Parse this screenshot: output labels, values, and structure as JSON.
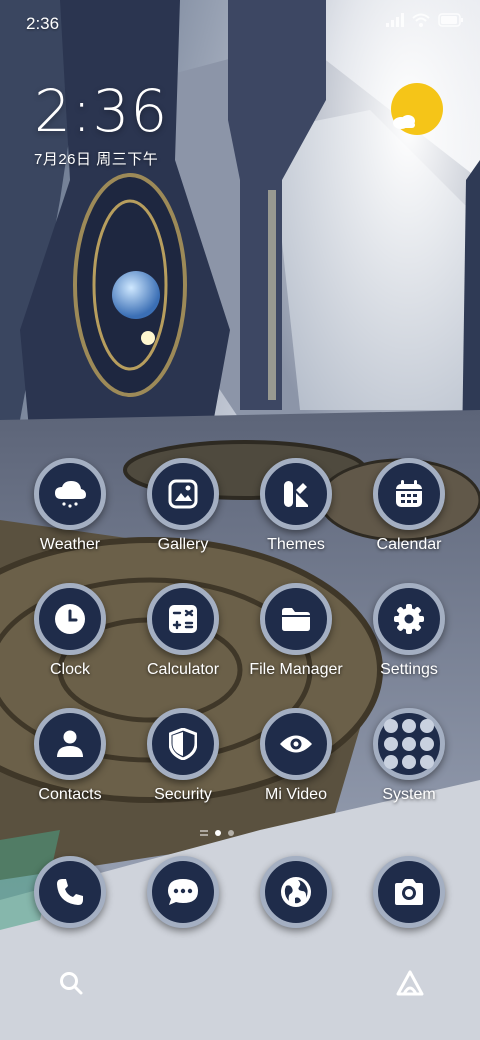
{
  "status_bar": {
    "time": "2:36",
    "icons": [
      "signal-icon",
      "wifi-icon",
      "battery-icon"
    ]
  },
  "clock_widget": {
    "time": "2:36",
    "date": "7月26日 周三下午",
    "weather_icon": "sun-cloud-icon",
    "sun_color": "#f5c518"
  },
  "apps": [
    {
      "label": "Weather",
      "icon": "weather-icon"
    },
    {
      "label": "Gallery",
      "icon": "gallery-icon"
    },
    {
      "label": "Themes",
      "icon": "themes-icon"
    },
    {
      "label": "Calendar",
      "icon": "calendar-icon"
    },
    {
      "label": "Clock",
      "icon": "clock-icon"
    },
    {
      "label": "Calculator",
      "icon": "calculator-icon"
    },
    {
      "label": "File Manager",
      "icon": "folder-icon"
    },
    {
      "label": "Settings",
      "icon": "gear-icon"
    },
    {
      "label": "Contacts",
      "icon": "contacts-icon"
    },
    {
      "label": "Security",
      "icon": "shield-icon"
    },
    {
      "label": "Mi Video",
      "icon": "eye-icon"
    },
    {
      "label": "System",
      "icon": "folder-grid-icon"
    }
  ],
  "dock": [
    {
      "icon": "phone-icon"
    },
    {
      "icon": "message-icon"
    },
    {
      "icon": "browser-globe-icon"
    },
    {
      "icon": "camera-icon"
    }
  ],
  "page_indicator": {
    "pages": 2,
    "current": 1
  },
  "bottom_bar": {
    "left": "search-icon",
    "right": "assistant-icon"
  },
  "colors": {
    "icon_bg": "#1f2c4a",
    "icon_ring": "#a4afc2"
  }
}
